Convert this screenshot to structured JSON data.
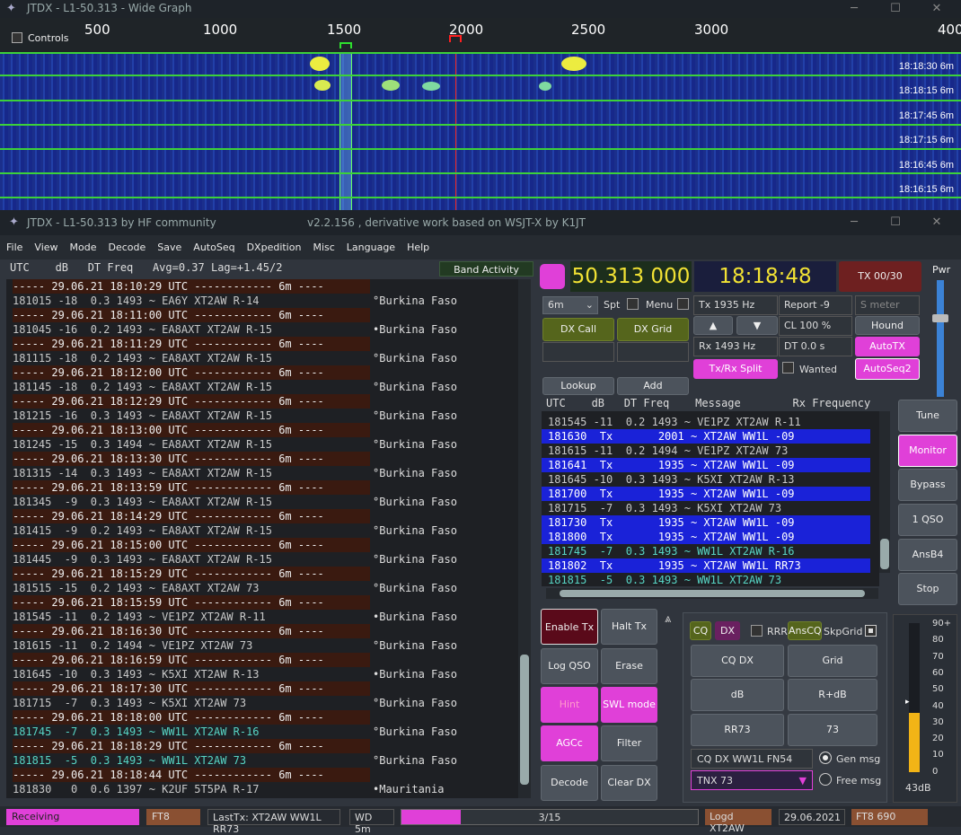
{
  "wide": {
    "title": "JTDX - L1-50.313 - Wide Graph",
    "controls": "Controls",
    "ruler": [
      "500",
      "1000",
      "1500",
      "2000",
      "2500",
      "3000",
      "400"
    ],
    "timestamps": [
      "18:18:30  6m",
      "18:18:15  6m",
      "18:17:45  6m",
      "18:17:15  6m",
      "18:16:45  6m",
      "18:16:15  6m"
    ]
  },
  "main": {
    "title": "JTDX - L1-50.313  by HF community",
    "subtitle": "v2.2.156 , derivative work based on WSJT-X by K1JT",
    "menu": [
      "File",
      "View",
      "Mode",
      "Decode",
      "Save",
      "AutoSeq",
      "DXpedition",
      "Misc",
      "Language",
      "Help"
    ],
    "left_header": "UTC    dB   DT Freq   Avg=0.37 Lag=+1.45/2",
    "band_activity": "Band Activity",
    "left_lines": [
      {
        "t": "sep",
        "x": "----- 29.06.21 18:10:29 UTC ------------ 6m ----"
      },
      {
        "t": "dec",
        "x": "181015 -18  0.3 1493 ~ EA6Y XT2AW R-14",
        "c": "°Burkina Faso"
      },
      {
        "t": "sep",
        "x": "----- 29.06.21 18:11:00 UTC ------------ 6m ----"
      },
      {
        "t": "dec",
        "x": "181045 -16  0.2 1493 ~ EA8AXT XT2AW R-15",
        "c": "•Burkina Faso"
      },
      {
        "t": "sep",
        "x": "----- 29.06.21 18:11:29 UTC ------------ 6m ----"
      },
      {
        "t": "dec",
        "x": "181115 -18  0.2 1493 ~ EA8AXT XT2AW R-15",
        "c": "°Burkina Faso"
      },
      {
        "t": "sep",
        "x": "----- 29.06.21 18:12:00 UTC ------------ 6m ----"
      },
      {
        "t": "dec",
        "x": "181145 -18  0.2 1493 ~ EA8AXT XT2AW R-15",
        "c": "°Burkina Faso"
      },
      {
        "t": "sep",
        "x": "----- 29.06.21 18:12:29 UTC ------------ 6m ----"
      },
      {
        "t": "dec",
        "x": "181215 -16  0.3 1493 ~ EA8AXT XT2AW R-15",
        "c": "°Burkina Faso"
      },
      {
        "t": "sep",
        "x": "----- 29.06.21 18:13:00 UTC ------------ 6m ----"
      },
      {
        "t": "dec",
        "x": "181245 -15  0.3 1494 ~ EA8AXT XT2AW R-15",
        "c": "°Burkina Faso"
      },
      {
        "t": "sep",
        "x": "----- 29.06.21 18:13:30 UTC ------------ 6m ----"
      },
      {
        "t": "dec",
        "x": "181315 -14  0.3 1493 ~ EA8AXT XT2AW R-15",
        "c": "°Burkina Faso"
      },
      {
        "t": "sep",
        "x": "----- 29.06.21 18:13:59 UTC ------------ 6m ----"
      },
      {
        "t": "dec",
        "x": "181345  -9  0.3 1493 ~ EA8AXT XT2AW R-15",
        "c": "°Burkina Faso"
      },
      {
        "t": "sep",
        "x": "----- 29.06.21 18:14:29 UTC ------------ 6m ----"
      },
      {
        "t": "dec",
        "x": "181415  -9  0.2 1493 ~ EA8AXT XT2AW R-15",
        "c": "°Burkina Faso"
      },
      {
        "t": "sep",
        "x": "----- 29.06.21 18:15:00 UTC ------------ 6m ----"
      },
      {
        "t": "dec",
        "x": "181445  -9  0.3 1493 ~ EA8AXT XT2AW R-15",
        "c": "°Burkina Faso"
      },
      {
        "t": "sep",
        "x": "----- 29.06.21 18:15:29 UTC ------------ 6m ----"
      },
      {
        "t": "dec",
        "x": "181515 -15  0.2 1493 ~ EA8AXT XT2AW 73",
        "c": "°Burkina Faso"
      },
      {
        "t": "sep",
        "x": "----- 29.06.21 18:15:59 UTC ------------ 6m ----"
      },
      {
        "t": "dec",
        "x": "181545 -11  0.2 1493 ~ VE1PZ XT2AW R-11",
        "c": "•Burkina Faso"
      },
      {
        "t": "sep",
        "x": "----- 29.06.21 18:16:30 UTC ------------ 6m ----"
      },
      {
        "t": "dec",
        "x": "181615 -11  0.2 1494 ~ VE1PZ XT2AW 73",
        "c": "°Burkina Faso"
      },
      {
        "t": "sep",
        "x": "----- 29.06.21 18:16:59 UTC ------------ 6m ----"
      },
      {
        "t": "dec",
        "x": "181645 -10  0.3 1493 ~ K5XI XT2AW R-13",
        "c": "•Burkina Faso"
      },
      {
        "t": "sep",
        "x": "----- 29.06.21 18:17:30 UTC ------------ 6m ----"
      },
      {
        "t": "dec",
        "x": "181715  -7  0.3 1493 ~ K5XI XT2AW 73",
        "c": "°Burkina Faso"
      },
      {
        "t": "sep",
        "x": "----- 29.06.21 18:18:00 UTC ------------ 6m ----"
      },
      {
        "t": "grn",
        "x": "181745  -7  0.3 1493 ~ WW1L XT2AW R-16",
        "c": "°Burkina Faso"
      },
      {
        "t": "sep",
        "x": "----- 29.06.21 18:18:29 UTC ------------ 6m ----"
      },
      {
        "t": "grn",
        "x": "181815  -5  0.3 1493 ~ WW1L XT2AW 73",
        "c": "°Burkina Faso"
      },
      {
        "t": "sep",
        "x": "----- 29.06.21 18:18:44 UTC ------------ 6m ----"
      },
      {
        "t": "dec",
        "x": "181830   0  0.6 1397 ~ K2UF 5T5PA R-17",
        "c": "•Mauritania"
      }
    ],
    "freq": "50.313 000",
    "clock": "18:18:48",
    "tx_counter": "TX 00/30",
    "pwr": "Pwr",
    "band": "6m",
    "spt": "Spt",
    "menu_label": "Menu",
    "tx_hz": "Tx  1935  Hz",
    "rx_hz": "Rx  1493  Hz",
    "report": "Report -9",
    "smeter": "S meter",
    "cl": "CL  100 %",
    "dt": "DT 0.0 s",
    "dx_call": "DX Call",
    "dx_grid": "DX Grid",
    "lookup": "Lookup",
    "add": "Add",
    "hound": "Hound",
    "autotx": "AutoTX",
    "txrx_split": "Tx/Rx Split",
    "wanted": "Wanted",
    "autoseq2": "AutoSeq2",
    "right_header": "UTC    dB   DT Freq    Message        Rx Frequency",
    "right_lines": [
      {
        "t": "dec",
        "x": "181545 -11  0.2 1493 ~ VE1PZ XT2AW R-11"
      },
      {
        "t": "tx",
        "x": "181630  Tx       2001 ~ XT2AW WW1L -09"
      },
      {
        "t": "dec",
        "x": "181615 -11  0.2 1494 ~ VE1PZ XT2AW 73"
      },
      {
        "t": "tx",
        "x": "181641  Tx       1935 ~ XT2AW WW1L -09"
      },
      {
        "t": "dec",
        "x": "181645 -10  0.3 1493 ~ K5XI XT2AW R-13"
      },
      {
        "t": "tx",
        "x": "181700  Tx       1935 ~ XT2AW WW1L -09"
      },
      {
        "t": "dec",
        "x": "181715  -7  0.3 1493 ~ K5XI XT2AW 73"
      },
      {
        "t": "tx",
        "x": "181730  Tx       1935 ~ XT2AW WW1L -09"
      },
      {
        "t": "tx",
        "x": "181800  Tx       1935 ~ XT2AW WW1L -09"
      },
      {
        "t": "grn",
        "x": "181745  -7  0.3 1493 ~ WW1L XT2AW R-16"
      },
      {
        "t": "tx",
        "x": "181802  Tx       1935 ~ XT2AW WW1L RR73"
      },
      {
        "t": "grn",
        "x": "181815  -5  0.3 1493 ~ WW1L XT2AW 73"
      }
    ],
    "side_buttons": [
      "Tune",
      "Monitor",
      "Bypass",
      "1 QSO",
      "AnsB4",
      "Stop"
    ],
    "ctrl": {
      "enable_tx": "Enable Tx",
      "halt_tx": "Halt Tx",
      "log_qso": "Log QSO",
      "erase": "Erase",
      "hint": "Hint",
      "swl_mode": "SWL mode",
      "agcc": "AGCc",
      "filter": "Filter",
      "decode": "Decode",
      "clear_dx": "Clear DX"
    },
    "msg": {
      "cq": "CQ",
      "dx": "DX",
      "rrr": "RRR",
      "anscq": "AnsCQ",
      "skpgrid": "SkpGrid",
      "cq_dx": "CQ DX",
      "grid": "Grid",
      "db": "dB",
      "rdb": "R+dB",
      "rr73": "RR73",
      "s73": "73",
      "cq_msg": "CQ DX WW1L FN54",
      "tnx": "TNX 73",
      "gen_msg": "Gen msg",
      "free_msg": "Free msg"
    },
    "meter": {
      "labels": [
        "90+",
        "80",
        "70",
        "60",
        "50",
        "40",
        "30",
        "20",
        "10",
        "0"
      ],
      "value_db": "43dB",
      "level": 43
    },
    "status": {
      "receiving": "Receiving",
      "mode": "FT8",
      "lasttx": "LastTx: XT2AW WW1L RR73",
      "wd": "WD 5m",
      "progress": "3/15",
      "progress_frac": 0.2,
      "logd": "Logd XT2AW",
      "date": "29.06.2021",
      "ft8": "FT8  690"
    }
  }
}
